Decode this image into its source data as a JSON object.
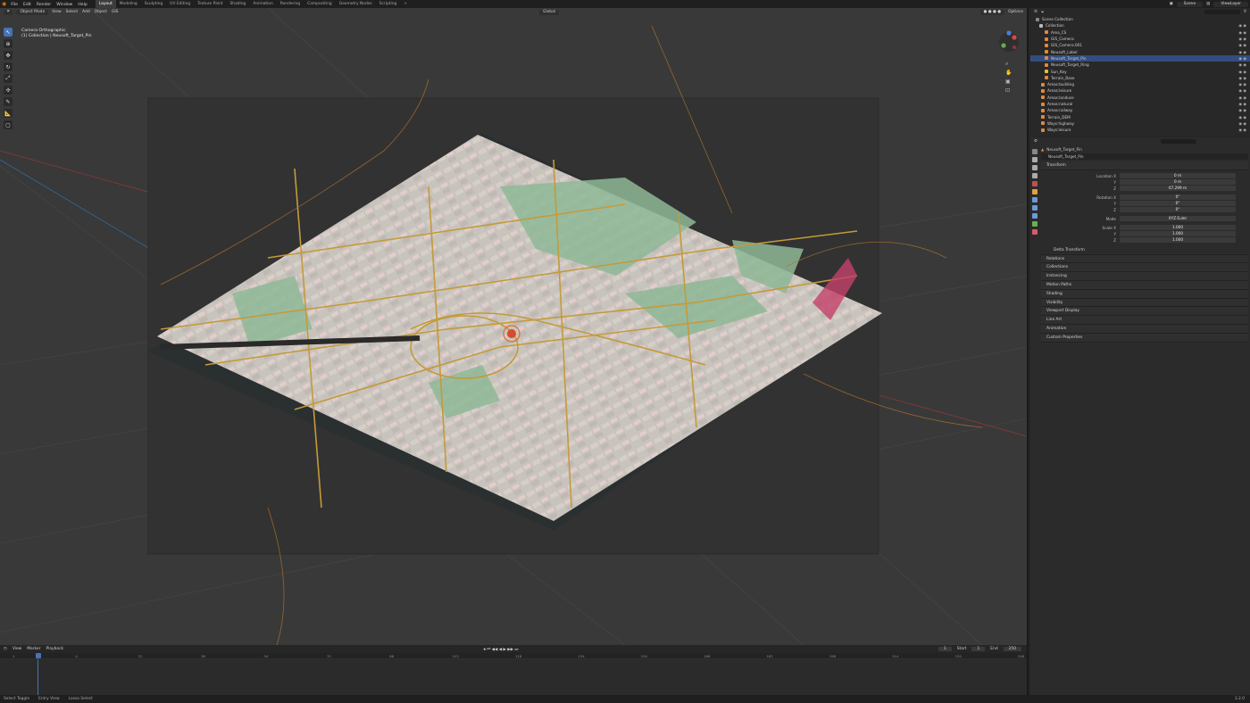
{
  "menu": [
    "File",
    "Edit",
    "Render",
    "Window",
    "Help"
  ],
  "workspaces": [
    "Layout",
    "Modeling",
    "Sculpting",
    "UV Editing",
    "Texture Paint",
    "Shading",
    "Animation",
    "Rendering",
    "Compositing",
    "Geometry Nodes",
    "Scripting",
    "+"
  ],
  "scene": {
    "name": "Scene",
    "view_layer": "ViewLayer"
  },
  "viewport": {
    "mode": "Object Mode",
    "menus": [
      "View",
      "Select",
      "Add",
      "Object",
      "GIS"
    ],
    "orientation": "Global",
    "options": "Options",
    "cam_line1": "Camera Orthographic",
    "cam_line2": "(1) Collection | Neusoft_Target_Pin"
  },
  "outliner": {
    "title": "Scene Collection",
    "search": "",
    "items": [
      {
        "label": "Collection",
        "color": "#bbbbbb"
      },
      {
        "label": "Area_CS",
        "color": "#e08a3a"
      },
      {
        "label": "GIS_Camera",
        "color": "#e08a3a"
      },
      {
        "label": "GIS_Camera.001",
        "color": "#e08a3a"
      },
      {
        "label": "Neusoft_Label",
        "color": "#e08a3a"
      },
      {
        "label": "Neusoft_Target_Pin",
        "color": "#e08a3a"
      },
      {
        "label": "Neusoft_Target_Ring",
        "color": "#e08a3a"
      },
      {
        "label": "Sun_Key",
        "color": "#e0c040"
      },
      {
        "label": "Terrain_Base",
        "color": "#e08a3a"
      },
      {
        "label": "Areas:building",
        "color": "#e08a3a"
      },
      {
        "label": "Areas:leisure",
        "color": "#e08a3a"
      },
      {
        "label": "Areas:landuse",
        "color": "#e08a3a"
      },
      {
        "label": "Areas:natural",
        "color": "#e08a3a"
      },
      {
        "label": "Areas:railway",
        "color": "#e08a3a"
      },
      {
        "label": "Terrain_DEM",
        "color": "#e08a3a"
      },
      {
        "label": "Ways:highway",
        "color": "#e08a3a"
      },
      {
        "label": "Ways:leisure",
        "color": "#e08a3a"
      }
    ]
  },
  "properties": {
    "object": "Neusoft_Target_Pin",
    "object_field": "Neusoft_Target_Pin",
    "transform": "Transform",
    "rows": [
      {
        "label": "Location X",
        "value": "0 m"
      },
      {
        "label": "Y",
        "value": "0 m"
      },
      {
        "label": "Z",
        "value": "67.299 m"
      },
      {
        "label": "Rotation X",
        "value": "0°"
      },
      {
        "label": "Y",
        "value": "0°"
      },
      {
        "label": "Z",
        "value": "0°"
      },
      {
        "label": "Mode",
        "value": "XYZ Euler"
      },
      {
        "label": "Scale X",
        "value": "1.000"
      },
      {
        "label": "Y",
        "value": "1.000"
      },
      {
        "label": "Z",
        "value": "1.000"
      }
    ],
    "delta": "Delta Transform",
    "sections": [
      "Relations",
      "Collections",
      "Instancing",
      "Motion Paths",
      "Shading",
      "Visibility",
      "Viewport Display",
      "Line Art",
      "Animation",
      "Custom Properties"
    ]
  },
  "timeline": {
    "menus": [
      "Playback",
      "View",
      "Marker"
    ],
    "current": "1",
    "start_label": "Start",
    "start": "1",
    "end_label": "End",
    "end": "250",
    "ticks": [
      "1",
      "4",
      "22",
      "38",
      "54",
      "70",
      "86",
      "102",
      "118",
      "134",
      "150",
      "166",
      "182",
      "198",
      "214",
      "230",
      "246"
    ]
  },
  "status": [
    "Select Toggle",
    "Entry View",
    "Lasso Select"
  ],
  "version": "3.2.0"
}
